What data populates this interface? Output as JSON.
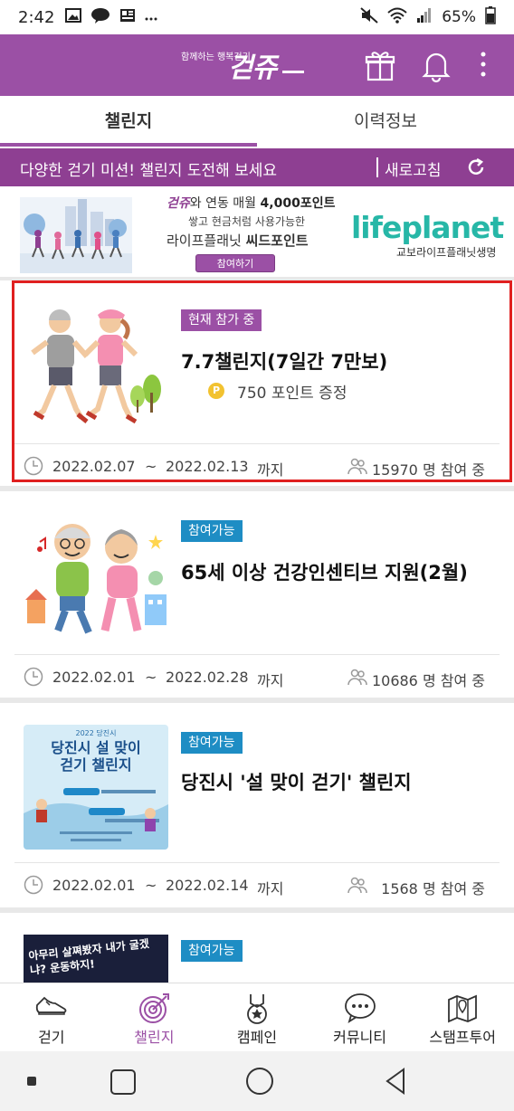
{
  "status_bar": {
    "time": "2:42",
    "battery": "65%",
    "left_icons": [
      "image-icon",
      "talk-icon",
      "news-icon",
      "more-icon"
    ],
    "right_icons": [
      "mute-icon",
      "wifi-icon",
      "signal-icon",
      "battery-icon"
    ]
  },
  "header": {
    "logo_tagline": "함께하는 행복걷기",
    "logo_text": "걷쥬",
    "icons": [
      "gift-icon",
      "bell-icon",
      "more-vert-icon"
    ]
  },
  "tabs": [
    {
      "label": "챌린지",
      "active": true
    },
    {
      "label": "이력정보",
      "active": false
    }
  ],
  "mission_bar": {
    "text": "다양한 걷기 미션! 챌린지 도전해 보세요",
    "refresh_label": "새로고침"
  },
  "banner": {
    "brand_mark": "걷쥬",
    "line1_rest": "와 연동 매월 ",
    "line1_points": "4,000포인트",
    "line2": "쌓고 현금처럼 사용가능한",
    "line3_a": "라이프플래닛 ",
    "line3_b": "씨드포인트",
    "join_button": "참여하기",
    "partner_logo": "lifeplanet",
    "partner_name": "교보라이프플래닛생명"
  },
  "challenges": [
    {
      "badge": "현재 참가 중",
      "title": "7.7챌린지(7일간 7만보)",
      "points_icon": "P",
      "points": "750 포인트 증정",
      "start": "2022.02.07",
      "tilde": "~",
      "end": "2022.02.13",
      "until": "까지",
      "participants": "15970 명 참여 중"
    },
    {
      "badge": "참여가능",
      "title": "65세 이상 건강인센티브 지원(2월)",
      "start": "2022.02.01",
      "tilde": "~",
      "end": "2022.02.28",
      "until": "까지",
      "participants": "10686 명 참여 중"
    },
    {
      "badge": "참여가능",
      "title": "당진시 '설 맞이 걷기' 챌린지",
      "poster_title": "당진시 설 맞이\n걷기 챌린지",
      "poster_top": "2022 당진시",
      "start": "2022.02.01",
      "tilde": "~",
      "end": "2022.02.14",
      "until": "까지",
      "participants": "1568 명 참여 중"
    },
    {
      "badge": "참여가능",
      "poster_text": "아무리 살쪄봤자 내가 굴겠냐? 운동하지!"
    }
  ],
  "bottom_nav": [
    {
      "label": "걷기",
      "icon": "shoe-icon",
      "active": false
    },
    {
      "label": "챌린지",
      "icon": "target-icon",
      "active": true
    },
    {
      "label": "캠페인",
      "icon": "medal-icon",
      "active": false
    },
    {
      "label": "커뮤니티",
      "icon": "chat-icon",
      "active": false
    },
    {
      "label": "스탬프투어",
      "icon": "map-icon",
      "active": false
    }
  ],
  "colors": {
    "brand": "#9b50a5",
    "mission_bar": "#8e3f92",
    "available_badge": "#1e8dc4",
    "highlight": "#e02020"
  }
}
